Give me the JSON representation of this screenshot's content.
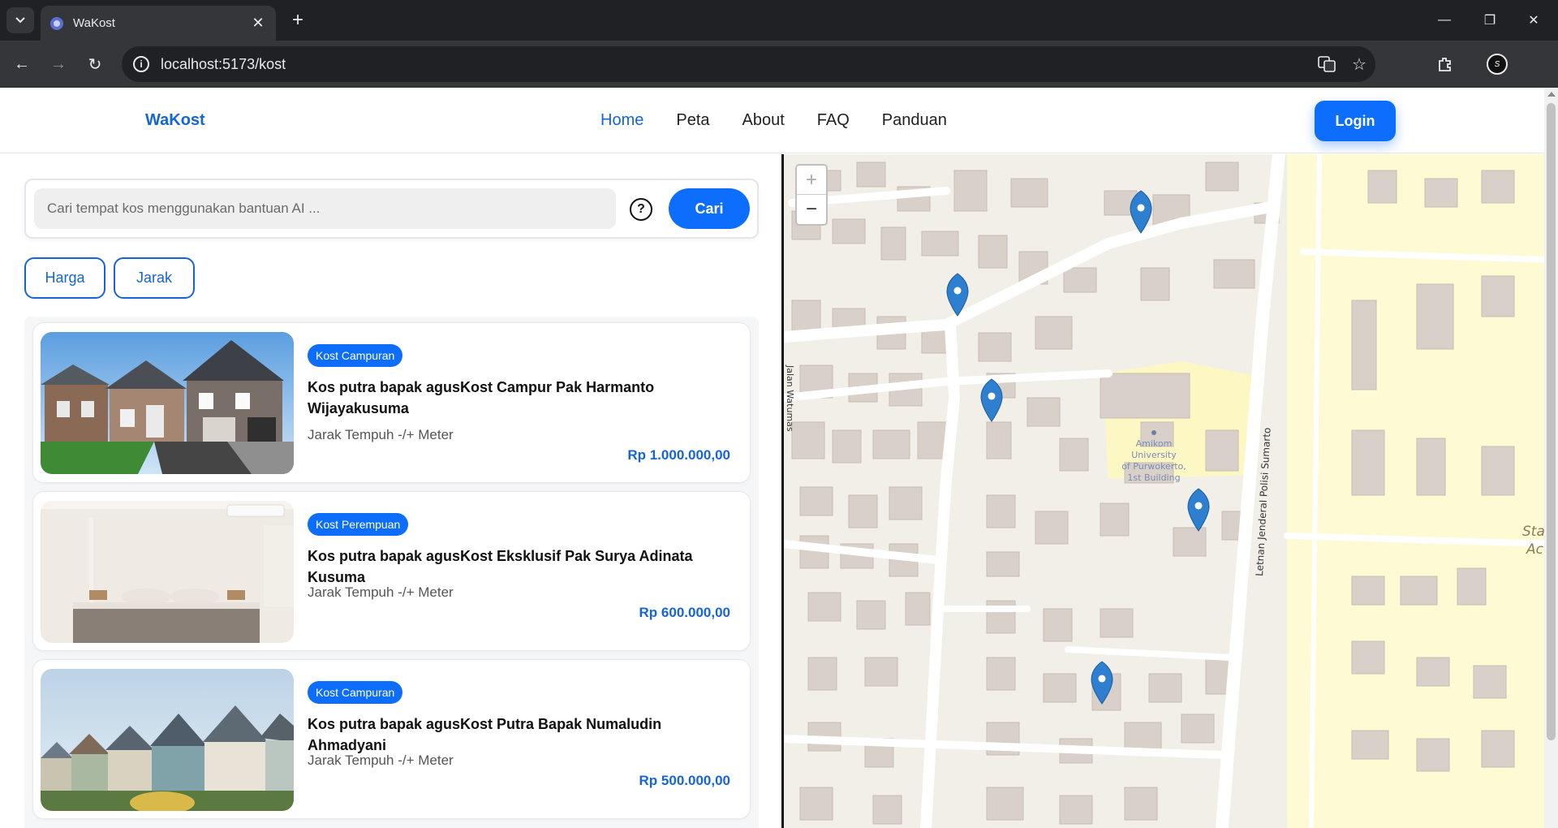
{
  "browser": {
    "tab_title": "WaKost",
    "url": "localhost:5173/kost",
    "profile_initials": "S"
  },
  "header": {
    "brand": "WaKost",
    "nav": [
      "Home",
      "Peta",
      "About",
      "FAQ",
      "Panduan"
    ],
    "login_label": "Login"
  },
  "search": {
    "placeholder": "Cari tempat kos menggunakan bantuan AI ...",
    "help_symbol": "?",
    "button_label": "Cari"
  },
  "filters": [
    "Harga",
    "Jarak"
  ],
  "listings": [
    {
      "badge": "Kost Campuran",
      "title": "Kos putra bapak agusKost Campur Pak Harmanto Wijayakusuma",
      "distance": "Jarak Tempuh -/+ Meter",
      "price": "Rp 1.000.000,00",
      "image": "house-photo"
    },
    {
      "badge": "Kost Perempuan",
      "title": "Kos putra bapak agusKost Eksklusif Pak Surya Adinata Kusuma",
      "distance": "Jarak Tempuh -/+ Meter",
      "price": "Rp 600.000,00",
      "image": "bedroom-photo"
    },
    {
      "badge": "Kost Campuran",
      "title": "Kos putra bapak agusKost Putra Bapak Numaludin Ahmadyani",
      "distance": "Jarak Tempuh -/+ Meter",
      "price": "Rp 500.000,00",
      "image": "row-houses-photo"
    }
  ],
  "map": {
    "zoom_in": "+",
    "zoom_out": "−",
    "labels": {
      "poi_line1": "Amikom",
      "poi_line2": "University",
      "poi_line3": "of Purwokerto,",
      "poi_line4": "1st Building",
      "road_east": "Letnan Jenderal Polisi Sumarto",
      "road_west": "Jalan Watumas",
      "edge_text1": "Sta",
      "edge_text2": "Ac"
    }
  }
}
